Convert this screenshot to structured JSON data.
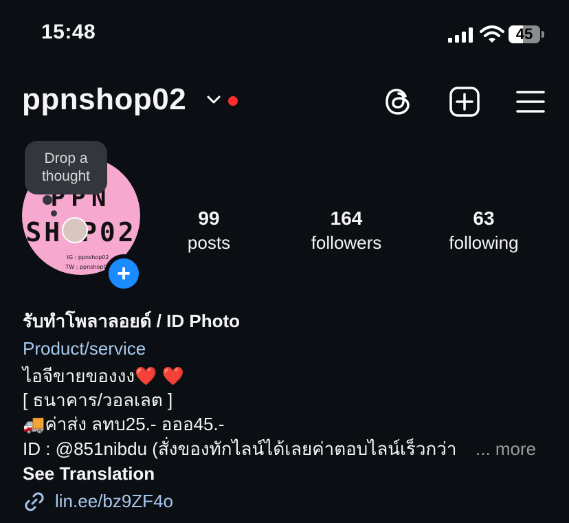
{
  "status_bar": {
    "time": "15:48",
    "battery": 45
  },
  "header": {
    "username": "ppnshop02"
  },
  "avatar": {
    "note_bubble": "Drop a thought",
    "lines": [
      "PPN",
      "SHOP02",
      "IG : ppnshop02",
      "TW : ppnshop02"
    ]
  },
  "stats": {
    "posts": {
      "count": "99",
      "label": "posts"
    },
    "followers": {
      "count": "164",
      "label": "followers"
    },
    "following": {
      "count": "63",
      "label": "following"
    }
  },
  "bio": {
    "name": "รับทำโพลาลอยด์ / ID Photo",
    "category": "Product/service",
    "line1": "ไอจีขายของงง❤️ ❤️",
    "line2": "[ ธนาคาร/วอลเลต ]",
    "line3": "🚚ค่าส่ง ลทบ25.- อออ45.-",
    "line4": "ID : @851nibdu (สั่งของทักไลน์ได้เลยค่าตอบไลน์เร็วกว่า",
    "more": "... more",
    "see_translation": "See Translation",
    "link": "lin.ee/bz9ZF4o"
  },
  "colors": {
    "background": "#0b0e13",
    "link": "#a7c8ee",
    "accent_blue": "#1a8cff",
    "live_dot": "#ff2d2d"
  },
  "icons": [
    "threads-icon",
    "create-post-icon",
    "menu-icon",
    "chevron-down-icon",
    "link-icon",
    "add-story-icon"
  ]
}
